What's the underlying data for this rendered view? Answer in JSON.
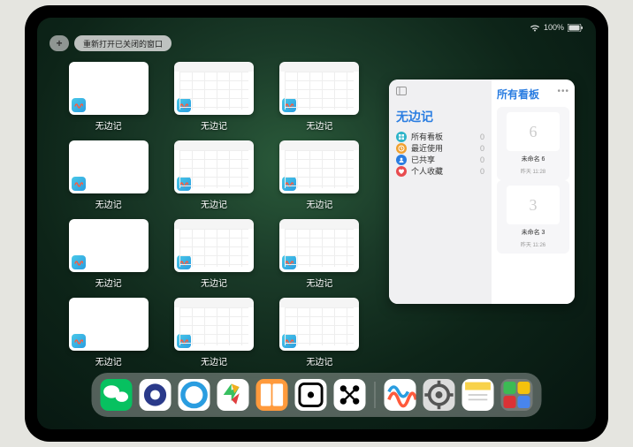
{
  "status": {
    "time": "",
    "battery": "100%"
  },
  "top": {
    "plus": "+",
    "reopen_label": "重新打开已关闭的窗口"
  },
  "app_label": "无边记",
  "windows": [
    {
      "style": "blank"
    },
    {
      "style": "cal"
    },
    {
      "style": "cal"
    },
    {
      "style": "blank"
    },
    {
      "style": "cal"
    },
    {
      "style": "cal"
    },
    {
      "style": "blank"
    },
    {
      "style": "cal"
    },
    {
      "style": "cal"
    },
    {
      "style": "blank"
    },
    {
      "style": "cal"
    },
    {
      "style": "cal"
    }
  ],
  "panel": {
    "left_title": "无边记",
    "items": [
      {
        "label": "所有看板",
        "count": "0",
        "color": "#2fb4c9",
        "icon": "grid"
      },
      {
        "label": "最近使用",
        "count": "0",
        "color": "#f0a030",
        "icon": "clock"
      },
      {
        "label": "已共享",
        "count": "0",
        "color": "#2a7de1",
        "icon": "person"
      },
      {
        "label": "个人收藏",
        "count": "0",
        "color": "#e84c50",
        "icon": "heart"
      }
    ],
    "right_title": "所有看板",
    "boards": [
      {
        "glyph": "6",
        "label": "未命名 6",
        "sub": "昨天 11:28"
      },
      {
        "glyph": "3",
        "label": "未命名 3",
        "sub": "昨天 11:26"
      }
    ]
  },
  "dock": [
    {
      "name": "wechat",
      "bg": "#07c160",
      "glyph": "wechat"
    },
    {
      "name": "quark",
      "bg": "#ffffff",
      "glyph": "quark"
    },
    {
      "name": "browser",
      "bg": "#ffffff",
      "glyph": "qcircle"
    },
    {
      "name": "play",
      "bg": "#ffffff",
      "glyph": "play"
    },
    {
      "name": "books",
      "bg": "#ff9a3c",
      "glyph": "books"
    },
    {
      "name": "dice",
      "bg": "#ffffff",
      "glyph": "dice"
    },
    {
      "name": "dots",
      "bg": "#ffffff",
      "glyph": "dots"
    },
    {
      "name": "freeform",
      "bg": "#ffffff",
      "glyph": "freeform"
    },
    {
      "name": "settings",
      "bg": "#dcdcdc",
      "glyph": "gear"
    },
    {
      "name": "notes",
      "bg": "#ffffff",
      "glyph": "notes"
    }
  ]
}
